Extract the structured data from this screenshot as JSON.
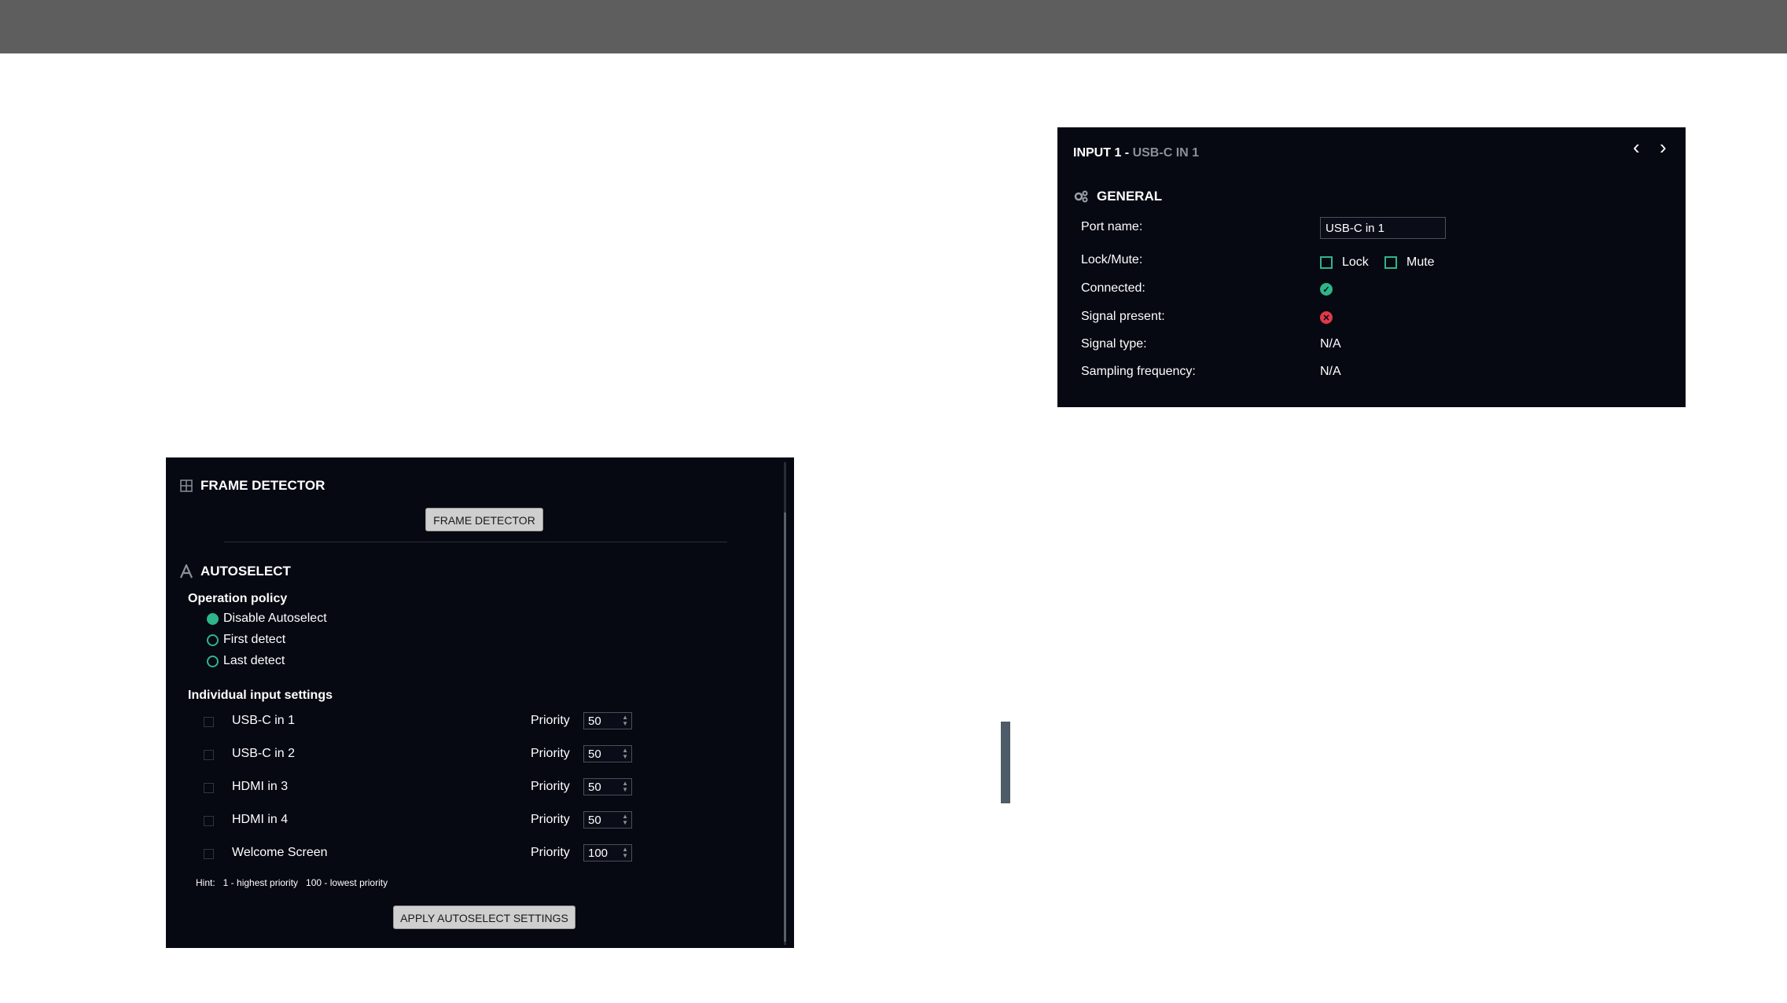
{
  "input_panel": {
    "title": "INPUT 1 -",
    "subtitle": "USB-C IN 1",
    "nav_prev": "‹",
    "nav_next": "›",
    "section": "GENERAL",
    "port_name_label": "Port name:",
    "port_name_value": "USB-C in 1",
    "lock_mute_label": "Lock/Mute:",
    "lock_label": "Lock",
    "mute_label": "Mute",
    "connected_label": "Connected:",
    "connected_status": "ok",
    "signal_present_label": "Signal present:",
    "signal_present_status": "error",
    "signal_type_label": "Signal type:",
    "signal_type_value": "N/A",
    "sampling_label": "Sampling frequency:",
    "sampling_value": "N/A"
  },
  "frame_detector": {
    "title": "FRAME DETECTOR",
    "button": "FRAME DETECTOR"
  },
  "autoselect": {
    "title": "AUTOSELECT",
    "policy_label": "Operation policy",
    "policies": [
      {
        "label": "Disable Autoselect",
        "selected": true
      },
      {
        "label": "First detect",
        "selected": false
      },
      {
        "label": "Last detect",
        "selected": false
      }
    ],
    "individual_label": "Individual input settings",
    "priority_label": "Priority",
    "inputs": [
      {
        "name": "USB-C in 1",
        "priority": "50"
      },
      {
        "name": "USB-C in 2",
        "priority": "50"
      },
      {
        "name": "HDMI in 3",
        "priority": "50"
      },
      {
        "name": "HDMI in 4",
        "priority": "50"
      },
      {
        "name": "Welcome Screen",
        "priority": "100"
      }
    ],
    "hint": "Hint:   1 - highest priority   100 - lowest priority",
    "apply_button": "APPLY AUTOSELECT SETTINGS"
  },
  "colors": {
    "panel_bg": "#060812",
    "accent": "#2fb58a",
    "error": "#e0394a",
    "topbar": "#5e5e5e"
  }
}
